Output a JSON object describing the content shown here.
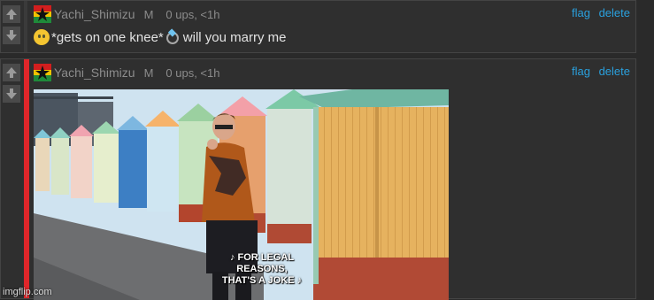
{
  "comments": [
    {
      "username": "Yachi_Shimizu",
      "badge": "M",
      "meta": "0 ups, <1h",
      "flag_label": "flag",
      "delete_label": "delete",
      "text_before": "*gets on one knee*",
      "text_after": " will you marry me"
    },
    {
      "username": "Yachi_Shimizu",
      "badge": "M",
      "meta": "0 ups, <1h",
      "flag_label": "flag",
      "delete_label": "delete",
      "meme_caption_line1": "♪ FOR LEGAL REASONS,",
      "meme_caption_line2": "THAT'S A JOKE ♪"
    }
  ],
  "watermark": "imgflip.com",
  "colors": {
    "link": "#2aa0dd",
    "accent_bar": "#e0262a",
    "background": "#2a2a2a"
  },
  "icons": [
    "upvote-arrow-icon",
    "downvote-arrow-icon",
    "user-flag-icon",
    "pleading-face-emoji",
    "ring-emoji"
  ]
}
